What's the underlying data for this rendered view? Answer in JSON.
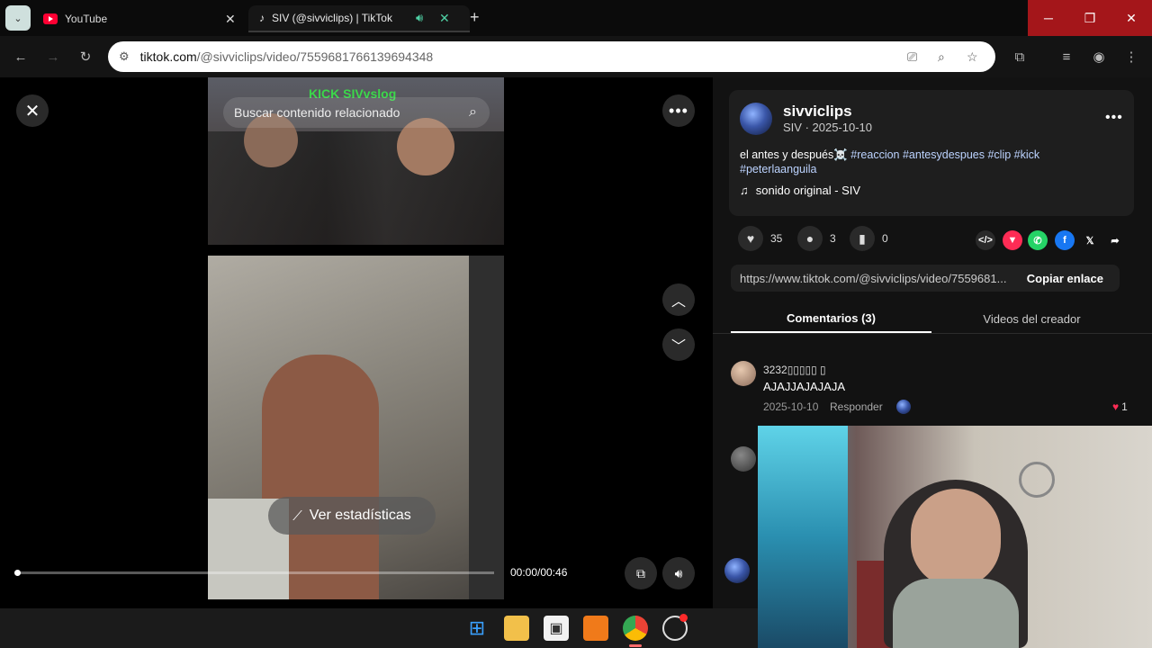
{
  "browser": {
    "tabs": [
      {
        "title": "YouTube",
        "active": false
      },
      {
        "title": "SIV (@sivviclips) | TikTok",
        "active": true
      }
    ],
    "new_tab": "+",
    "url_host": "tiktok.com",
    "url_path": "/@sivviclips/video/7559681766139694348"
  },
  "video": {
    "search_placeholder": "Buscar contenido relacionado",
    "overlay_text": "KICK SIVvslog",
    "stats_button": "Ver estadísticas",
    "time": "00:00/00:46",
    "progress": 0.0
  },
  "post": {
    "username": "sivviclips",
    "meta": "SIV · 2025-10-10",
    "caption_text": "el antes y después☠️",
    "hashtags_line1": "#reaccion #antesydespues #clip #kick",
    "hashtags_line2": "#peterlaanguila",
    "sound": "sonido original - SIV",
    "likes": "35",
    "comments": "3",
    "saves": "0",
    "link": "https://www.tiktok.com/@sivviclips/video/7559681...",
    "copy_link": "Copiar enlace"
  },
  "panel_tabs": [
    {
      "label": "Comentarios (3)",
      "active": true
    },
    {
      "label": "Videos del creador",
      "active": false
    }
  ],
  "comments": [
    {
      "author": "3232▯▯▯▯▯ ▯",
      "text": "AJAJJAJAJAJA",
      "date": "2025-10-10",
      "reply": "Responder",
      "likes": "1"
    }
  ],
  "colors": {
    "accent": "#fe2c55",
    "hashtag": "#bcd3ff",
    "panel_bg": "#121212"
  }
}
